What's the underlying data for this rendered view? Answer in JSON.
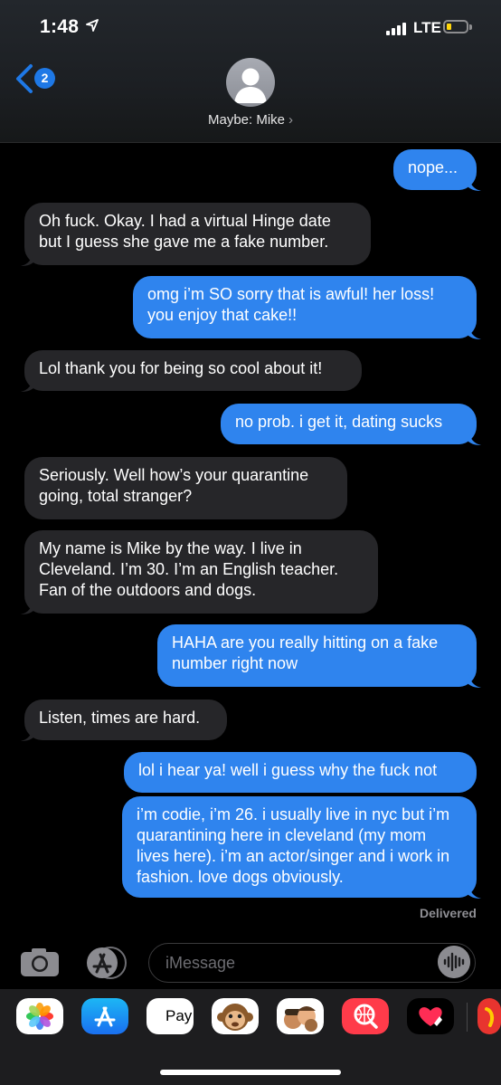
{
  "status_bar": {
    "time": "1:48",
    "network": "LTE"
  },
  "header": {
    "back_count": "2",
    "contact": "Maybe: Mike"
  },
  "messages": [
    {
      "side": "sent",
      "text": "nope..."
    },
    {
      "side": "recv",
      "text": "Oh fuck. Okay. I had a virtual Hinge date but I guess she gave me a fake number."
    },
    {
      "side": "sent",
      "text": "omg i’m SO sorry that is awful! her loss! you enjoy that cake!!"
    },
    {
      "side": "recv",
      "text": "Lol thank you for being so cool about it!"
    },
    {
      "side": "sent",
      "text": "no prob. i get it, dating sucks"
    },
    {
      "side": "recv",
      "text": "Seriously. Well how’s your quarantine going, total stranger?"
    },
    {
      "side": "recv",
      "text": "My name is Mike by the way. I live in Cleveland. I’m 30. I’m an English teacher. Fan of the outdoors and dogs."
    },
    {
      "side": "sent",
      "text": "HAHA are you really hitting on a fake number right now"
    },
    {
      "side": "recv",
      "text": "Listen, times are hard."
    },
    {
      "side": "sent",
      "text": "lol i hear ya! well i guess why the fuck not"
    },
    {
      "side": "sent",
      "text": "i’m codie, i’m 26. i usually live in nyc but i’m quarantining here in cleveland (my mom lives here). i’m an actor/singer and i work in fashion. love dogs obviously."
    }
  ],
  "delivered": "Delivered",
  "compose": {
    "placeholder": "iMessage"
  },
  "app_tray": {
    "apple_pay": "Pay",
    "icons": [
      "photos-icon",
      "app-store-icon",
      "apple-pay-icon",
      "animoji-icon",
      "memoji-icon",
      "search-images-icon",
      "digital-touch-icon",
      "more-app-icon"
    ]
  },
  "colors": {
    "sent": "#2f84ee",
    "received": "#262629",
    "accent": "#1e78e6"
  }
}
